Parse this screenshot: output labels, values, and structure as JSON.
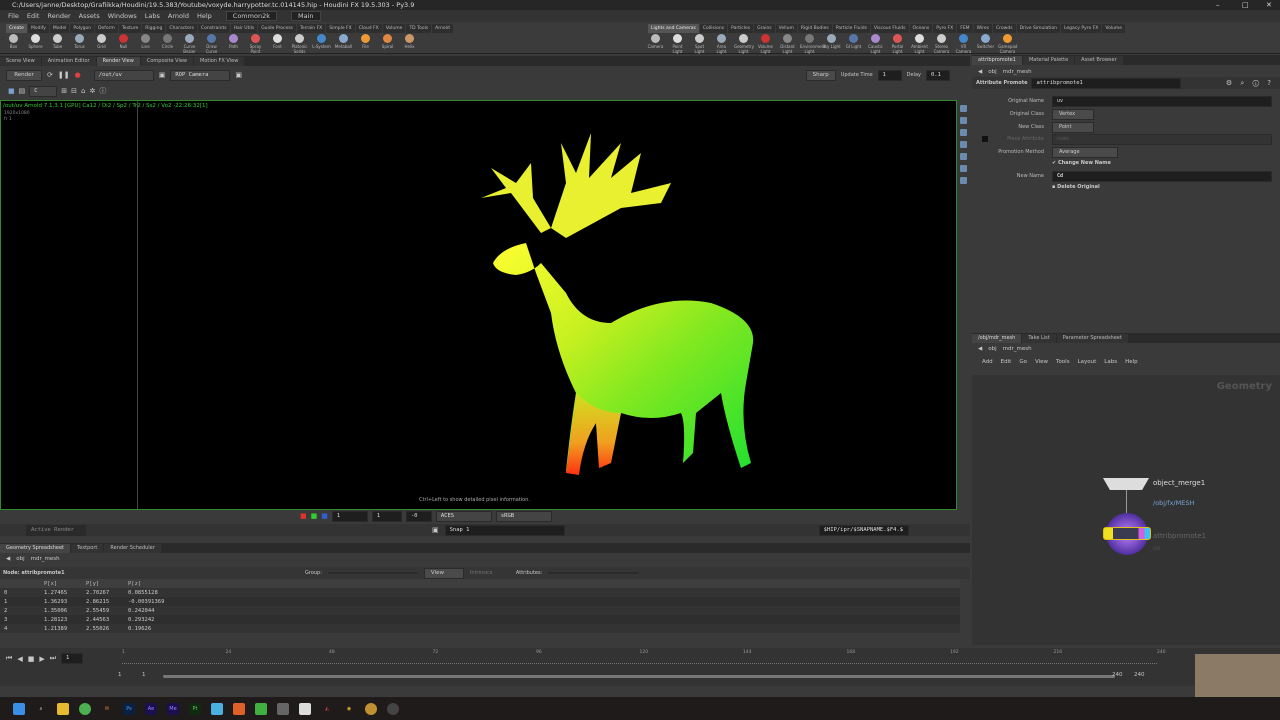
{
  "window": {
    "title": "C:/Users/janne/Desktop/Grafiikka/Houdini/19.5.383/Youtube/voxyde.harrypotter.tc.014145.hip - Houdini FX 19.5.303 - Py3.9"
  },
  "menu": {
    "items": [
      "File",
      "Edit",
      "Render",
      "Assets",
      "Windows",
      "Labs",
      "Arnold",
      "Help"
    ],
    "desktop": "Common2k",
    "context": "Main"
  },
  "shelf_left": {
    "tabs": [
      "Create",
      "Modify",
      "Model",
      "Polygon",
      "Deform",
      "Texture",
      "Rigging",
      "Characters",
      "Constraints",
      "Hair Utils",
      "Guide Process",
      "Terrain FX",
      "Simple FX",
      "Cloud FX",
      "Volume",
      "TD Tools",
      "Arnold"
    ],
    "tools": [
      "Box",
      "Sphere",
      "Tube",
      "Torus",
      "Grid",
      "Null",
      "Line",
      "Circle",
      "Curve Bezier",
      "Draw Curve",
      "Path",
      "Spray Paint",
      "Font",
      "Platonic Solids",
      "L-System",
      "Metaball",
      "File",
      "Spiral",
      "Helix"
    ]
  },
  "shelf_right": {
    "tabs": [
      "Lights and Cameras",
      "Collisions",
      "Particles",
      "Grains",
      "Vellum",
      "Rigid Bodies",
      "Particle Fluids",
      "Viscous Fluids",
      "Oceans",
      "Pyro FX",
      "FEM",
      "Wires",
      "Crowds",
      "Drive Simulation",
      "Legacy Pyro FX",
      "Volume"
    ],
    "tools": [
      "Camera",
      "Point Light",
      "Spot Light",
      "Area Light",
      "Geometry Light",
      "Volume Light",
      "Distant Light",
      "Environment Light",
      "Sky Light",
      "GI Light",
      "Caustic Light",
      "Portal Light",
      "Ambient Light",
      "Stereo Camera",
      "VR Camera",
      "Switcher",
      "Gamepad Camera"
    ]
  },
  "left_pane": {
    "tabs": [
      "Scene View",
      "Animation Editor",
      "Render View",
      "Composite View",
      "Motion FX View"
    ],
    "render_button": "Render",
    "rop_path": "/out/uv",
    "camera": "ROP Camera",
    "aov": "C",
    "shading": "Sharp",
    "update_time_label": "Update Time",
    "update_time": "1",
    "delay_label": "Delay",
    "delay": "0.1",
    "render_info": "/out/uv  Arnold 7.1.3.1 [GPU]  Ca12 / Di2 / Sp2 / Tr2 / Ss2 / Vo2 -22:26:32[1]",
    "resolution": "1920x1080",
    "frame_info": "fr 1",
    "hint": "Ctrl+Left to show detailed pixel information.",
    "exposure": "1",
    "gamma": "1",
    "offset": "-0",
    "ocio": "ACES",
    "display": "sRGB",
    "active_render": "Active Render",
    "snap": "Snap 1",
    "snapshot_path": "$HIP/ipr/$SNAPNAME.$F4.$"
  },
  "spreadsheet": {
    "tabs": [
      "Geometry Spreadsheet",
      "Textport",
      "Render Scheduler"
    ],
    "path": [
      "obj",
      "mdr_mesh"
    ],
    "node": "Node: attribpromote1",
    "group_label": "Group:",
    "view": "View",
    "intrinsics": "Intrinsics",
    "attributes_label": "Attributes:",
    "columns": [
      "",
      "P[x]",
      "P[y]",
      "P[z]"
    ],
    "rows": [
      [
        "0",
        "1.27465",
        "2.70267",
        "0.0855128"
      ],
      [
        "1",
        "1.36293",
        "2.86215",
        "-0.00391369"
      ],
      [
        "2",
        "1.35006",
        "2.55459",
        "0.242044"
      ],
      [
        "3",
        "1.28123",
        "2.44563",
        "0.293242"
      ],
      [
        "4",
        "1.21389",
        "2.55026",
        "0.19626"
      ]
    ]
  },
  "params": {
    "tabs": [
      "attribpromote1",
      "Material Palette",
      "Asset Browser"
    ],
    "path": [
      "obj",
      "mdr_mesh"
    ],
    "node_type": "Attribute Promote",
    "node_name": "attribpromote1",
    "fields": [
      {
        "label": "Original Name",
        "value": "uv"
      },
      {
        "label": "Original Class",
        "value": "Vertex"
      },
      {
        "label": "New Class",
        "value": "Point"
      },
      {
        "label": "Piece Attribute",
        "value": "name"
      },
      {
        "label": "Promotion Method",
        "value": "Average"
      },
      {
        "label": "New Name",
        "value": "Cd"
      }
    ],
    "change_new_name": "Change New Name",
    "delete_original": "Delete Original"
  },
  "network": {
    "tabs": [
      "/obj/mdr_mesh",
      "Take List",
      "Parameter Spreadsheet"
    ],
    "path": [
      "obj",
      "mdr_mesh"
    ],
    "menu": [
      "Add",
      "Edit",
      "Go",
      "View",
      "Tools",
      "Layout",
      "Labs",
      "Help"
    ],
    "context_label": "Geometry",
    "nodes": [
      {
        "name": "object_merge1",
        "sub": "/obj/fx/MESH"
      },
      {
        "name": "attribpromote1",
        "sub": "uv"
      }
    ]
  },
  "timeline": {
    "frame": "1",
    "ticks": [
      "1",
      "24",
      "48",
      "72",
      "96",
      "120",
      "144",
      "168",
      "192",
      "216",
      "240"
    ],
    "start": "1",
    "start2": "1",
    "end": "240",
    "end2": "240"
  },
  "taskbar": {
    "apps": [
      "Ps",
      "Ae",
      "Me",
      "Pt"
    ]
  }
}
